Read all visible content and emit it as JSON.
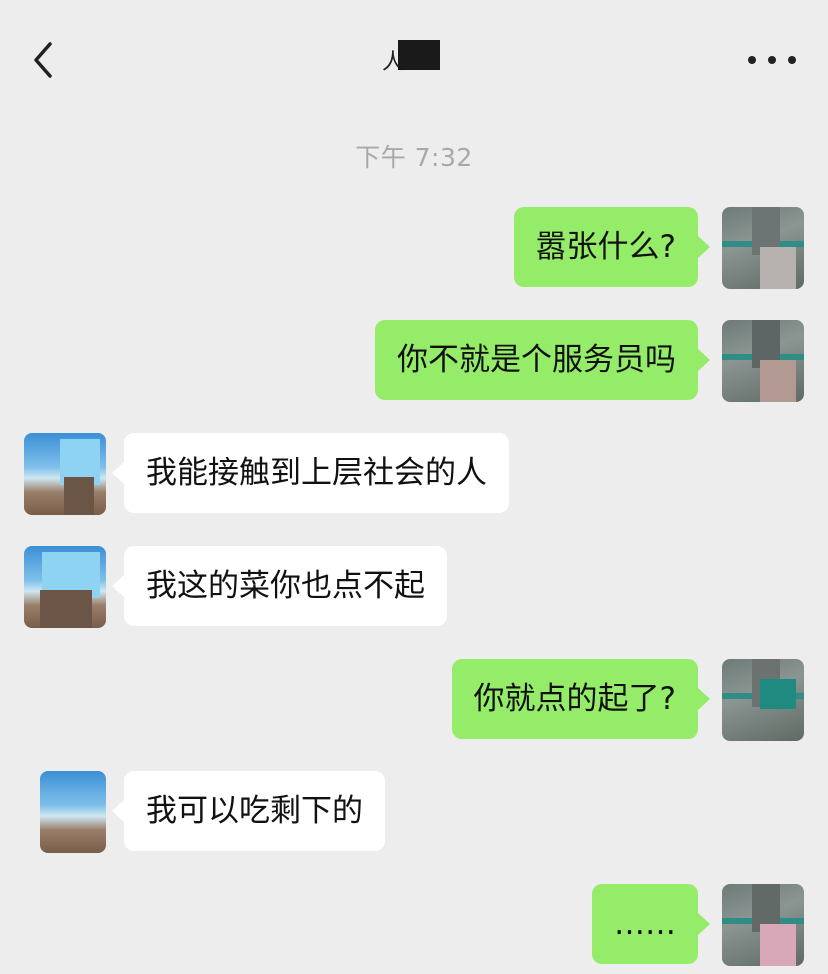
{
  "header": {
    "title_fragment": "人",
    "more_label": "•••"
  },
  "timestamp": "下午 7:32",
  "messages": [
    {
      "side": "out",
      "text": "嚣张什么?"
    },
    {
      "side": "out",
      "text": "你不就是个服务员吗"
    },
    {
      "side": "in",
      "text": "我能接触到上层社会的人"
    },
    {
      "side": "in",
      "text": "我这的菜你也点不起"
    },
    {
      "side": "out",
      "text": "你就点的起了?"
    },
    {
      "side": "in",
      "text": "我可以吃剩下的"
    },
    {
      "side": "out",
      "text": "……"
    }
  ],
  "colors": {
    "background": "#ededed",
    "outgoing_bubble": "#95ec69",
    "incoming_bubble": "#ffffff",
    "timestamp_text": "#a8a8a8"
  },
  "icons": {
    "back": "chevron-left-icon",
    "more": "more-horizontal-icon"
  }
}
